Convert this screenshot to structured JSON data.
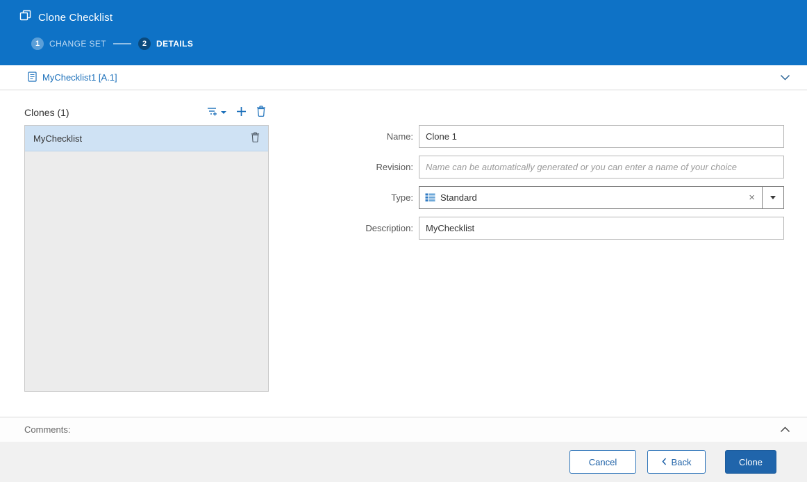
{
  "header": {
    "title": "Clone Checklist",
    "steps": [
      {
        "number": "1",
        "label": "CHANGE SET"
      },
      {
        "number": "2",
        "label": "DETAILS"
      }
    ]
  },
  "context_bar": {
    "item_label": "MyChecklist1 [A.1]"
  },
  "clones_panel": {
    "title": "Clones (1)",
    "items": [
      {
        "name": "MyChecklist",
        "selected": true
      }
    ]
  },
  "form": {
    "name": {
      "label": "Name:",
      "value": "Clone 1"
    },
    "revision": {
      "label": "Revision:",
      "placeholder": "Name can be automatically generated or you can enter a name of your choice"
    },
    "type": {
      "label": "Type:",
      "value": "Standard",
      "clear_glyph": "×"
    },
    "description": {
      "label": "Description:",
      "value": "MyChecklist"
    }
  },
  "comments": {
    "label": "Comments:"
  },
  "footer": {
    "cancel_label": "Cancel",
    "back_label": "Back",
    "clone_label": "Clone"
  },
  "icons": {
    "clone": "overlapping-squares",
    "checklist": "document-list",
    "filter_add": "filter-plus",
    "add": "plus",
    "delete": "trash",
    "type": "table-grid",
    "collapse": "chevron-up",
    "expand": "chevron-down",
    "back": "chevron-left"
  },
  "colors": {
    "header_blue": "#0e72c6",
    "step_active_circle": "#0a4a7d",
    "link_blue": "#1a6fba",
    "selected_row": "#cfe2f4",
    "primary_button": "#2065ab",
    "button_border": "#2a72b8"
  }
}
